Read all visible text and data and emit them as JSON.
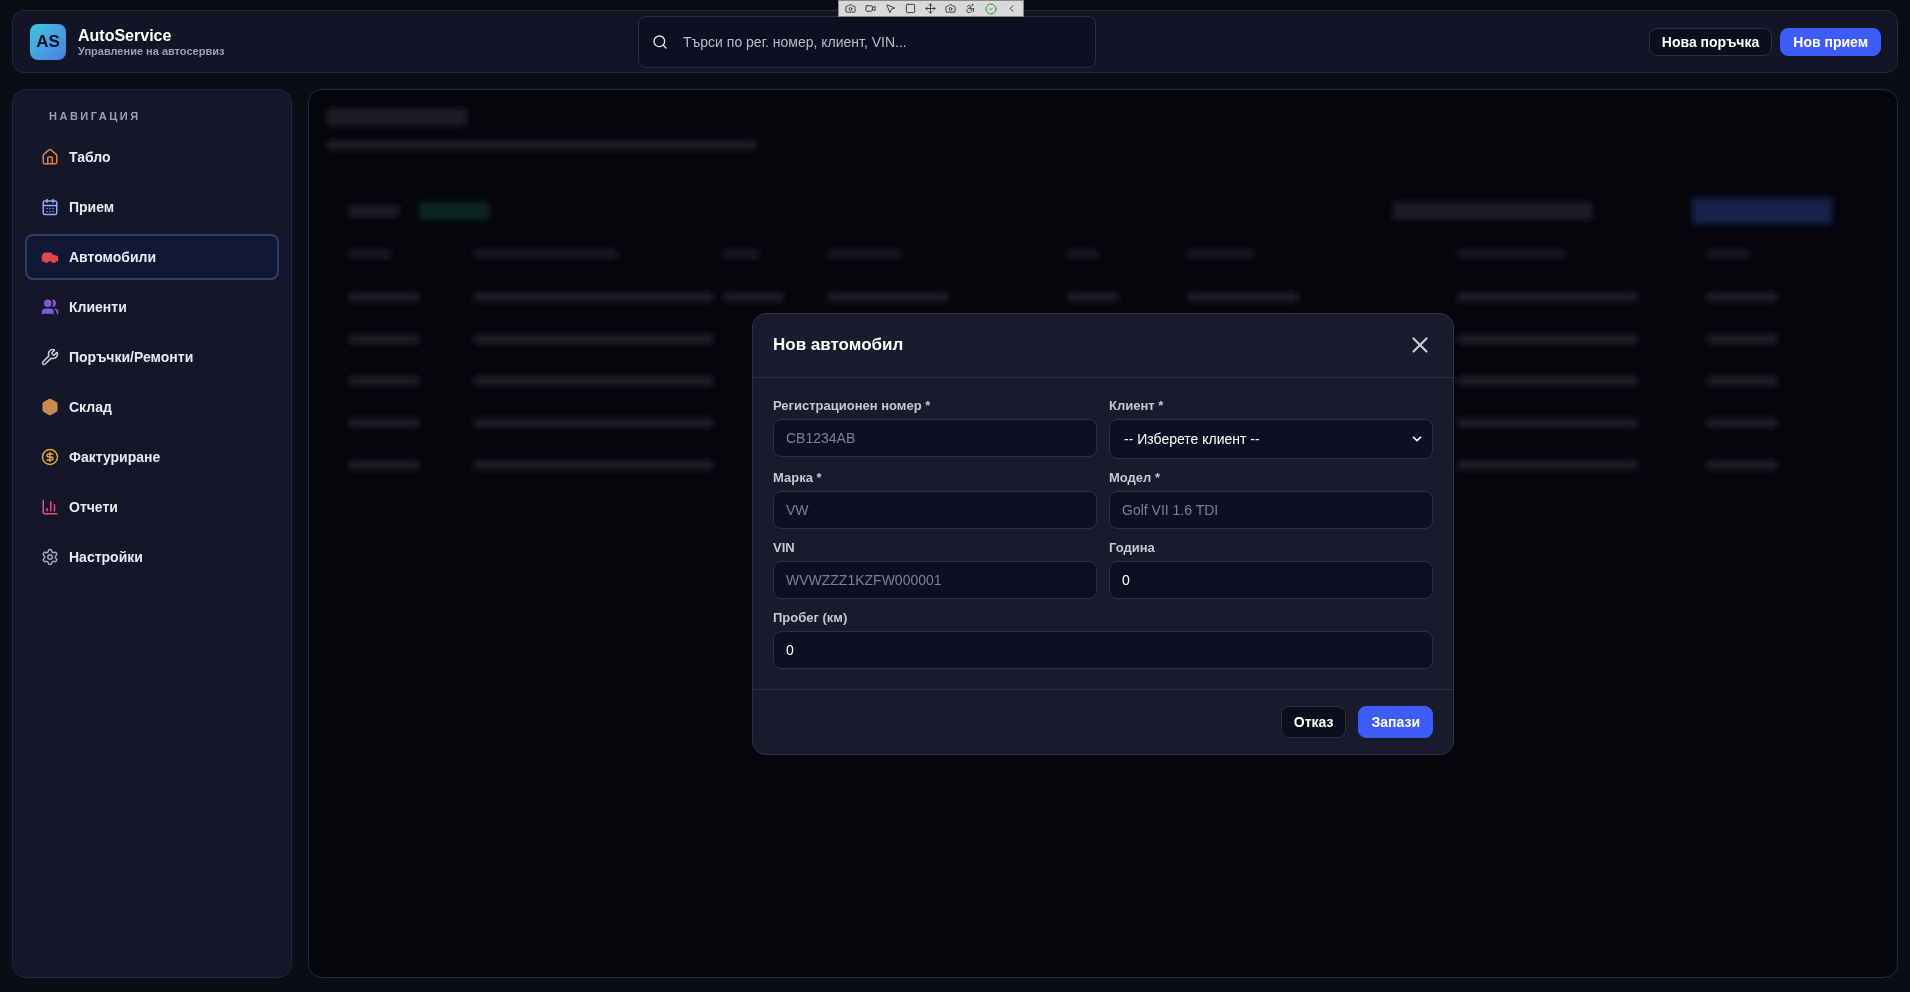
{
  "header": {
    "logo": "AS",
    "app_name": "AutoService",
    "subtitle": "Управление на автосервиз",
    "search": {
      "placeholder": "Търси по рег. номер, клиент, VIN..."
    },
    "buttons": [
      {
        "label": "Нова поръчка",
        "kind": "secondary"
      },
      {
        "label": "Нов прием",
        "kind": "primary"
      }
    ]
  },
  "sidebar": {
    "heading": "НАВИГАЦИЯ",
    "items": [
      {
        "label": "Табло",
        "selected": false
      },
      {
        "label": "Прием",
        "selected": false
      },
      {
        "label": "Автомобили",
        "selected": true
      },
      {
        "label": "Клиенти",
        "selected": false
      },
      {
        "label": "Поръчки/Ремонти",
        "selected": false
      },
      {
        "label": "Склад",
        "selected": false
      },
      {
        "label": "Фактуриране",
        "selected": false
      },
      {
        "label": "Отчети",
        "selected": false
      },
      {
        "label": "Настройки",
        "selected": false
      }
    ]
  },
  "modal": {
    "title": "Нов автомобил",
    "fields": [
      {
        "label": "Регистрационен номер *",
        "kind": "text",
        "placeholder": "CB1234AB"
      },
      {
        "label": "Клиент *",
        "kind": "select",
        "value": "-- Изберете клиент --"
      },
      {
        "label": "Марка *",
        "kind": "text",
        "placeholder": "VW"
      },
      {
        "label": "Модел *",
        "kind": "text",
        "placeholder": "Golf VII 1.6 TDI"
      },
      {
        "label": "VIN",
        "kind": "text",
        "placeholder": "WVWZZZ1KZFW000001"
      },
      {
        "label": "Година",
        "kind": "text",
        "value": "0"
      },
      {
        "label": "Пробег (км)",
        "kind": "text",
        "value": "0"
      }
    ],
    "buttons": [
      {
        "label": "Отказ",
        "kind": "secondary"
      },
      {
        "label": "Запази",
        "kind": "primary"
      }
    ]
  }
}
